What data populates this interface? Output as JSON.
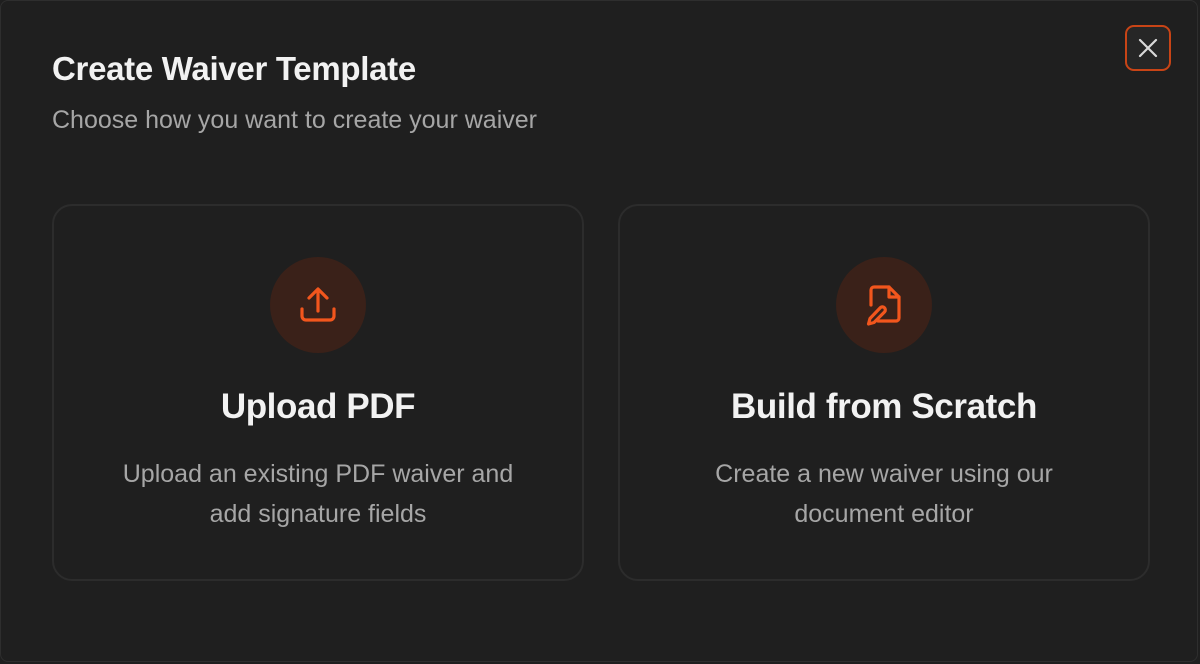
{
  "dialog": {
    "title": "Create Waiver Template",
    "subtitle": "Choose how you want to create your waiver",
    "close_icon": "x-icon"
  },
  "options": [
    {
      "icon": "upload-icon",
      "title": "Upload PDF",
      "description": "Upload an existing PDF waiver and add signature fields"
    },
    {
      "icon": "file-edit-icon",
      "title": "Build from Scratch",
      "description": "Create a new waiver using our document editor"
    }
  ],
  "colors": {
    "background": "#1f1f1f",
    "accent": "#f2561d",
    "icon_circle": "#3a2119",
    "card_border": "#2c2c2c",
    "text_primary": "#f2f2f2",
    "text_secondary": "#a6a6a6"
  }
}
